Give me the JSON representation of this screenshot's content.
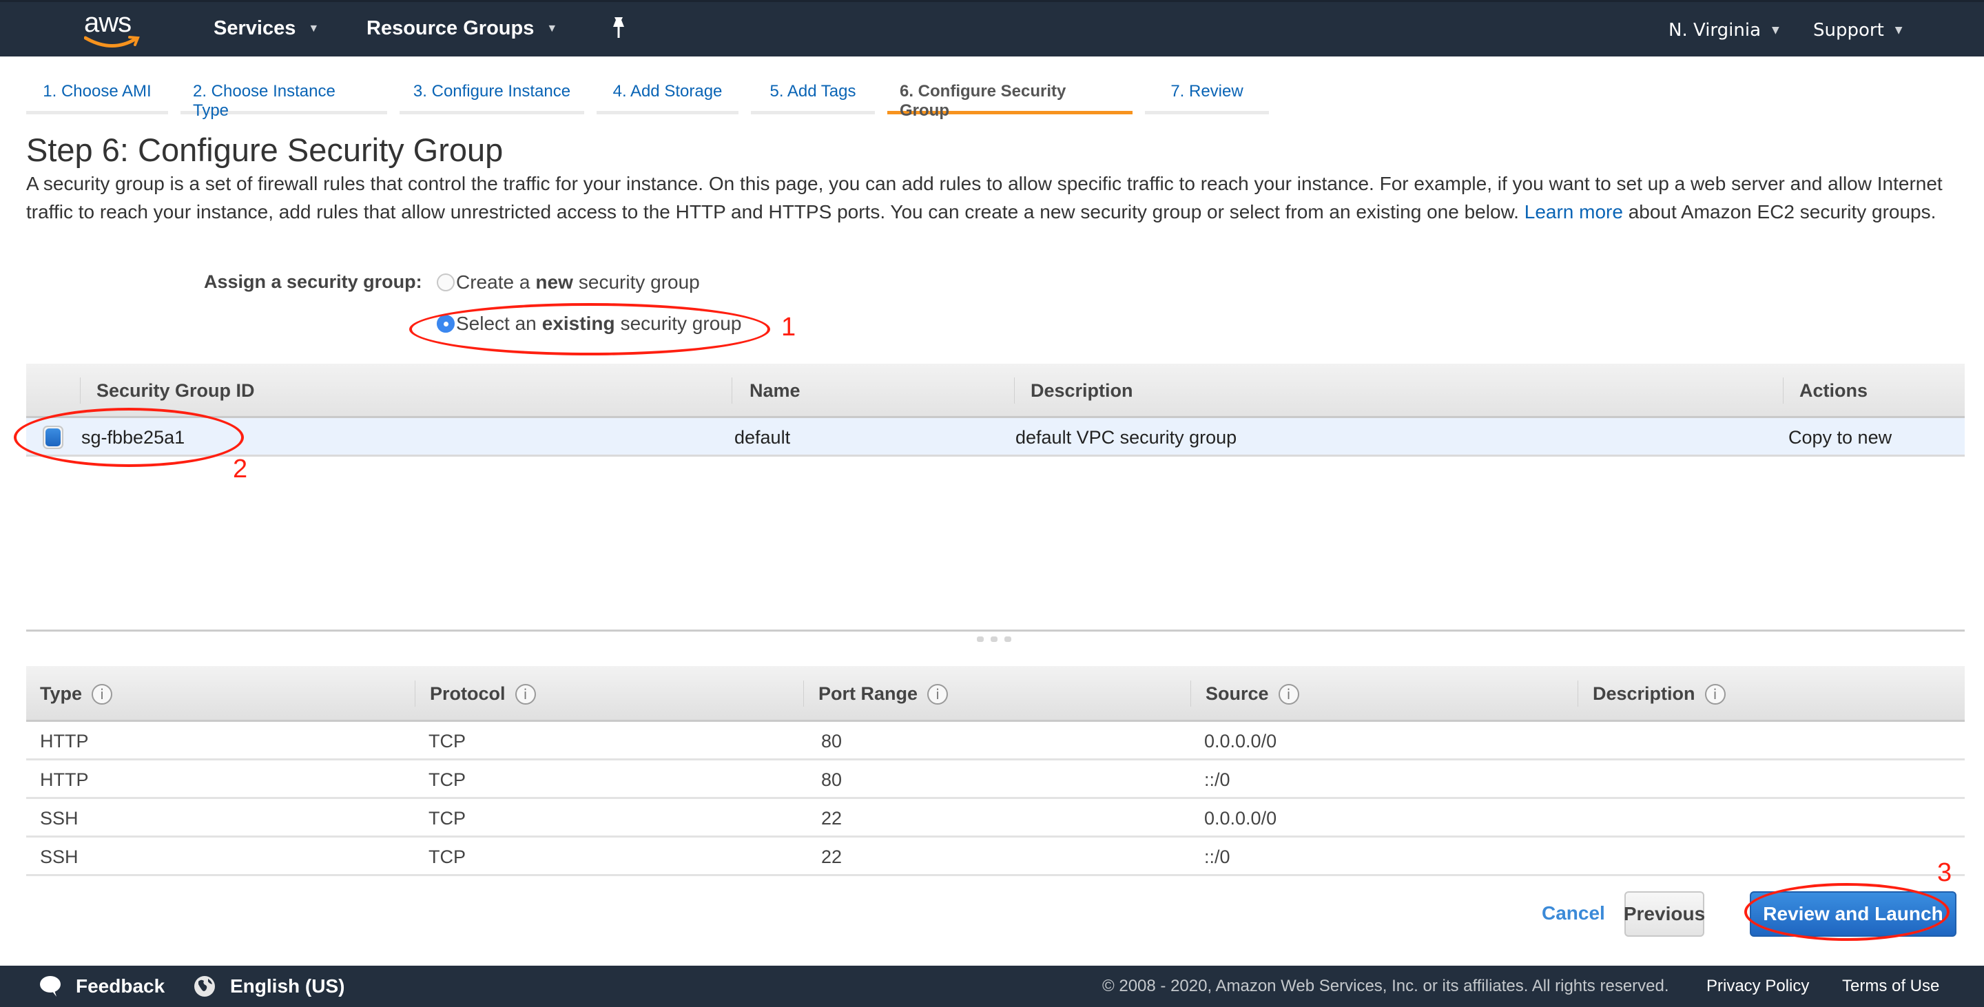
{
  "header": {
    "logo_text": "aws",
    "services_label": "Services",
    "resource_groups_label": "Resource Groups",
    "region_label": "N. Virginia",
    "support_label": "Support",
    "chevron_glyph": "▼",
    "pin_glyph": "📌"
  },
  "tabs": [
    {
      "label": "1. Choose AMI",
      "active": false
    },
    {
      "label": "2. Choose Instance Type",
      "active": false
    },
    {
      "label": "3. Configure Instance",
      "active": false
    },
    {
      "label": "4. Add Storage",
      "active": false
    },
    {
      "label": "5. Add Tags",
      "active": false
    },
    {
      "label": "6. Configure Security Group",
      "active": true
    },
    {
      "label": "7. Review",
      "active": false
    }
  ],
  "page": {
    "title": "Step 6: Configure Security Group",
    "intro_before_link": "A security group is a set of firewall rules that control the traffic for your instance. On this page, you can add rules to allow specific traffic to reach your instance. For example, if you want to set up a web server and allow Internet traffic to reach your instance, add rules that allow unrestricted access to the HTTP and HTTPS ports. You can create a new security group or select from an existing one below. ",
    "intro_link": "Learn more",
    "intro_after_link": " about Amazon EC2 security groups."
  },
  "assign": {
    "label": "Assign a security group:",
    "options": [
      {
        "prefix": "Create a ",
        "bold": "new",
        "suffix": " security group",
        "selected": false
      },
      {
        "prefix": "Select an ",
        "bold": "existing",
        "suffix": " security group",
        "selected": true
      }
    ]
  },
  "security_groups": {
    "columns": [
      "Security Group ID",
      "Name",
      "Description",
      "Actions"
    ],
    "rows": [
      {
        "id": "sg-fbbe25a1",
        "name": "default",
        "description": "default VPC security group",
        "action": "Copy to new",
        "selected": true
      }
    ]
  },
  "rules": {
    "columns": [
      "Type",
      "Protocol",
      "Port Range",
      "Source",
      "Description"
    ],
    "info_glyph": "i",
    "rows": [
      {
        "type": "HTTP",
        "protocol": "TCP",
        "port": "80",
        "source": "0.0.0.0/0",
        "description": ""
      },
      {
        "type": "HTTP",
        "protocol": "TCP",
        "port": "80",
        "source": "::/0",
        "description": ""
      },
      {
        "type": "SSH",
        "protocol": "TCP",
        "port": "22",
        "source": "0.0.0.0/0",
        "description": ""
      },
      {
        "type": "SSH",
        "protocol": "TCP",
        "port": "22",
        "source": "::/0",
        "description": ""
      }
    ]
  },
  "actions": {
    "cancel_label": "Cancel",
    "previous_label": "Previous",
    "launch_label": "Review and Launch"
  },
  "annotations": [
    "1",
    "2",
    "3"
  ],
  "footer": {
    "feedback_label": "Feedback",
    "language_label": "English (US)",
    "copyright": "© 2008 - 2020, Amazon Web Services, Inc. or its affiliates. All rights reserved.",
    "privacy_label": "Privacy Policy",
    "terms_label": "Terms of Use"
  },
  "colors": {
    "header_bg": "#232f3e",
    "active_tab": "#f7931e",
    "link": "#0a64b5",
    "primary_button": "#1f66c1",
    "annotation": "#ff1f10",
    "selected_row": "#eaf2fd"
  }
}
